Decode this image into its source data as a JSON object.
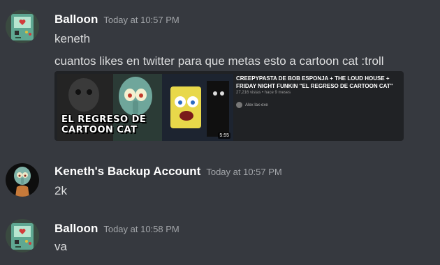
{
  "messages": [
    {
      "username": "Balloon",
      "timestamp": "Today at 10:57 PM",
      "lines": [
        "keneth",
        "cuantos likes en twitter para que metas esto a cartoon cat :troll"
      ],
      "embed": {
        "title": "CREEPYPASTA DE BOB ESPONJA + THE LOUD HOUSE + FRIDAY NIGHT FUNKIN \"EL REGRESO DE CARTOON CAT\"",
        "meta": "27,216 vistas • hace 9 meses",
        "channel": "Alex lax-exe",
        "thumbnail_text_line1": "EL REGRESO DE",
        "thumbnail_text_line2": "CARTOON CAT",
        "duration": "5:55"
      }
    },
    {
      "username": "Keneth's Backup Account",
      "timestamp": "Today at 10:57 PM",
      "lines": [
        "2k"
      ]
    },
    {
      "username": "Balloon",
      "timestamp": "Today at 10:58 PM",
      "lines": [
        "va"
      ]
    }
  ],
  "colors": {
    "background": "#36393f",
    "username": "#ffffff",
    "timestamp": "#a3a6aa",
    "text": "#dcddde",
    "embed_bg": "#202225"
  }
}
